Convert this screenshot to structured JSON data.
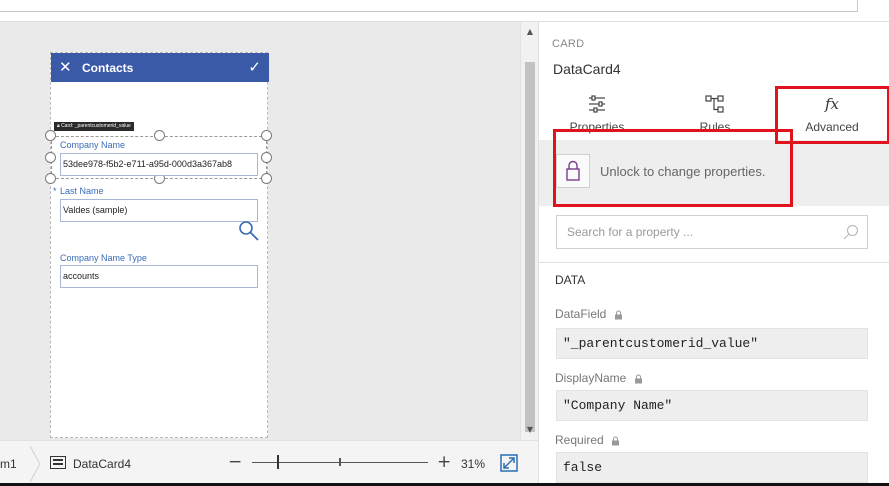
{
  "form": {
    "title": "Contacts",
    "card_tag": "Card: _parentcustomerid_value",
    "fields": [
      {
        "label": "Company Name",
        "value": "53dee978-f5b2-e711-a95d-000d3a367ab8"
      },
      {
        "label": "Last Name",
        "required_mark": "*",
        "value": "Valdes (sample)"
      },
      {
        "label": "Company Name Type",
        "value": "accounts"
      }
    ]
  },
  "bottombar": {
    "crumb_screen": "m1",
    "crumb_card": "DataCard4",
    "zoom": "31%",
    "zoom_minus": "−",
    "zoom_plus": "+"
  },
  "panel": {
    "kind": "CARD",
    "name": "DataCard4",
    "tabs": [
      {
        "label": "Properties"
      },
      {
        "label": "Rules"
      },
      {
        "label": "Advanced",
        "glyph": "fx"
      }
    ],
    "lock_message": "Unlock to change properties.",
    "search_placeholder": "Search for a property ...",
    "section": "DATA",
    "properties": [
      {
        "name": "DataField",
        "value": "\"_parentcustomerid_value\""
      },
      {
        "name": "DisplayName",
        "value": "\"Company Name\""
      },
      {
        "name": "Required",
        "value": "false"
      }
    ]
  },
  "colors": {
    "header_blue": "#3a5aa8",
    "highlight_red": "#e0131c",
    "lock_purple": "#7a3d8c"
  }
}
